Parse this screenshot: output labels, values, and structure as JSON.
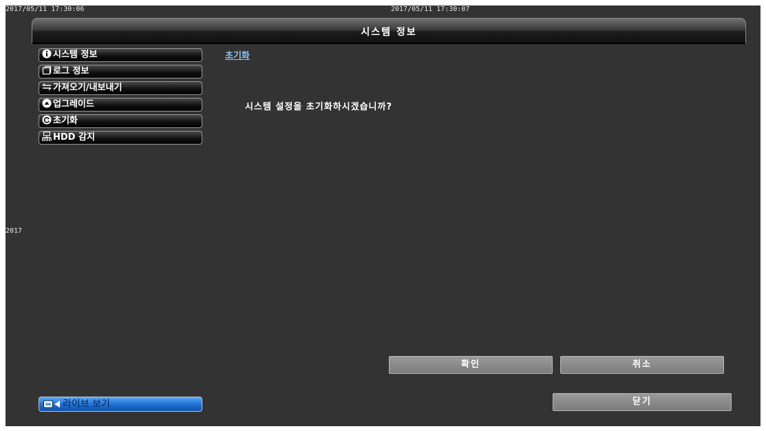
{
  "timestamps": {
    "left": "2017/05/11 17:30:06",
    "center": "2017/05/11 17:30:07",
    "side": "2017"
  },
  "window": {
    "title": "시스템 정보"
  },
  "menu": {
    "items": [
      {
        "label": "시스템 정보",
        "icon": "info-icon"
      },
      {
        "label": "로그 정보",
        "icon": "log-icon"
      },
      {
        "label": "가져오기/내보내기",
        "icon": "import-export-icon"
      },
      {
        "label": "업그레이드",
        "icon": "upgrade-icon"
      },
      {
        "label": "초기화",
        "icon": "reset-icon"
      },
      {
        "label": "HDD 감지",
        "icon": "hdd-icon"
      }
    ]
  },
  "live": {
    "label": "라이브 보기",
    "icon": "live-view-icon"
  },
  "content": {
    "section_title": "초기화",
    "message": "시스템 설정을 초기화하시겠습니까?"
  },
  "buttons": {
    "ok": "확인",
    "cancel": "취소",
    "close": "닫기"
  },
  "colors": {
    "background": "#333333",
    "link": "#8fc4f4",
    "live_button": "#1d6fd0",
    "button_gray": "#8a8a8a"
  }
}
